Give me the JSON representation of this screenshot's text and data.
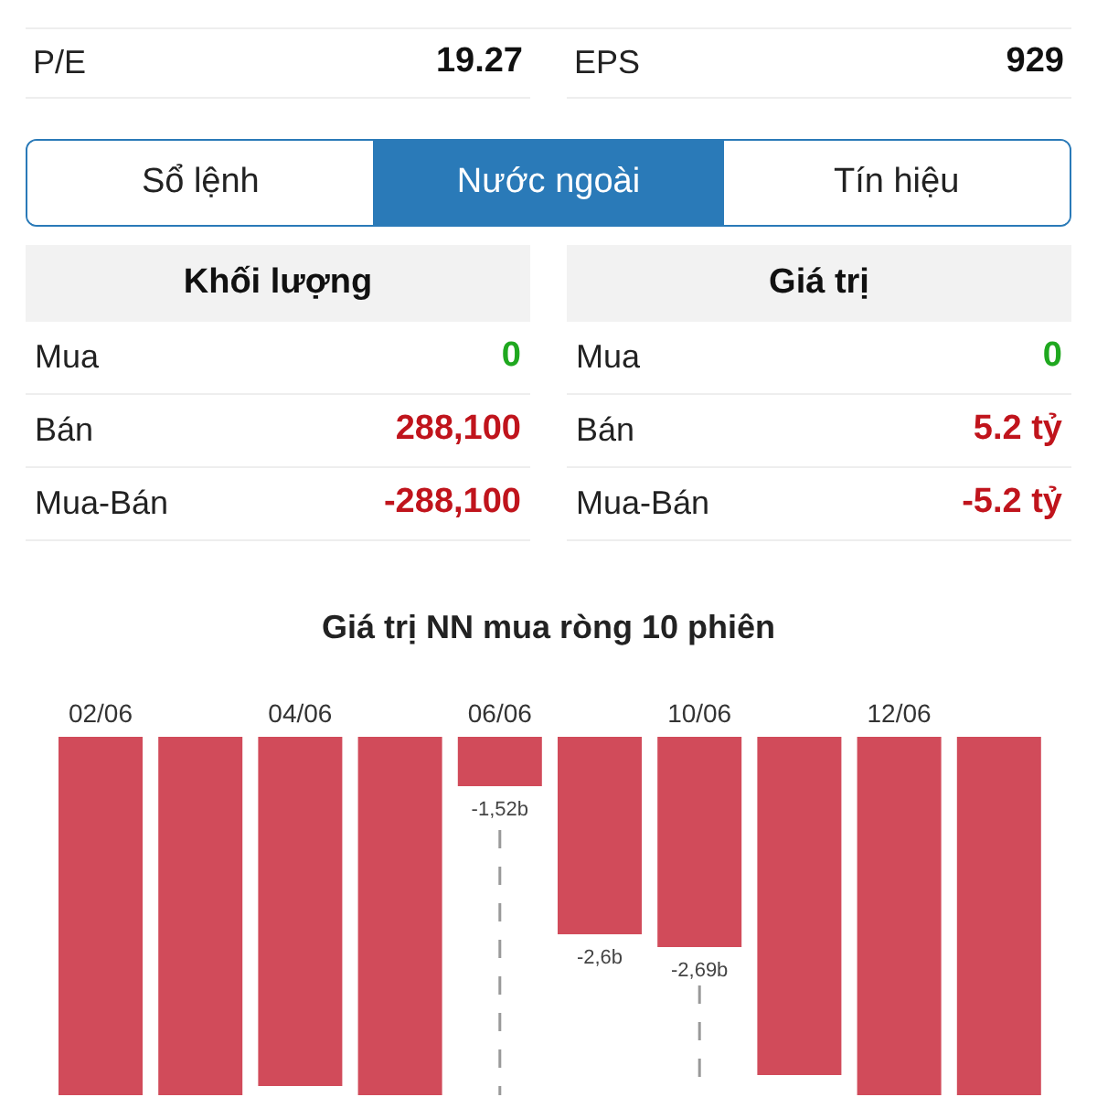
{
  "stats": [
    {
      "label": "P/E",
      "value": "19.27"
    },
    {
      "label": "EPS",
      "value": "929"
    }
  ],
  "tabs": [
    {
      "label": "Sổ lệnh",
      "selected": false
    },
    {
      "label": "Nước ngoài",
      "selected": true
    },
    {
      "label": "Tín hiệu",
      "selected": false
    }
  ],
  "tables": [
    {
      "heading": "Khối lượng",
      "rows": [
        {
          "label": "Mua",
          "value": "0",
          "color": "#1fa81f"
        },
        {
          "label": "Bán",
          "value": "288,100",
          "color": "#c0141c"
        },
        {
          "label": "Mua-Bán",
          "value": "-288,100",
          "color": "#c0141c"
        }
      ]
    },
    {
      "heading": "Giá trị",
      "rows": [
        {
          "label": "Mua",
          "value": "0",
          "color": "#1fa81f"
        },
        {
          "label": "Bán",
          "value": "5.2 tỷ",
          "color": "#c0141c"
        },
        {
          "label": "Mua-Bán",
          "value": "-5.2 tỷ",
          "color": "#c0141c"
        }
      ]
    }
  ],
  "chart": {
    "title": "Giá trị NN mua ròng 10 phiên",
    "date_labels": [
      "02/06",
      "04/06",
      "06/06",
      "10/06",
      "12/06"
    ],
    "value_labels": [
      "-1,52b",
      "-2,6b",
      "-2,69b"
    ]
  }
}
